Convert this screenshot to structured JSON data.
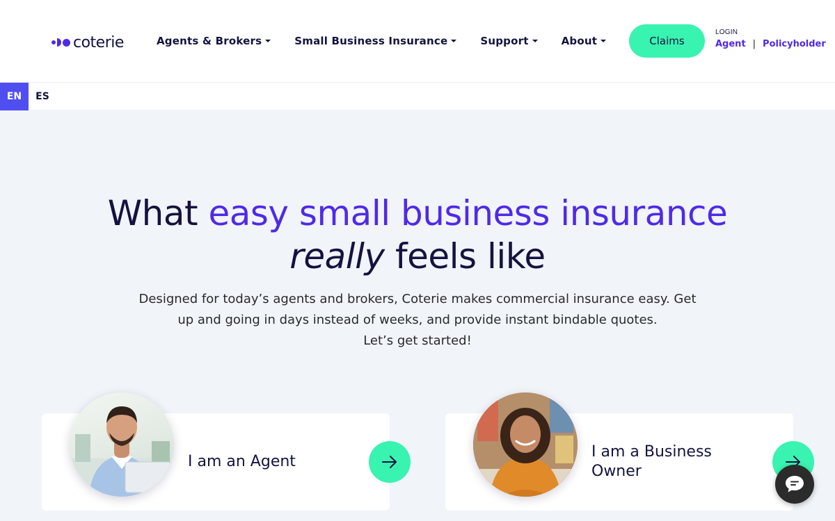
{
  "brand": {
    "name": "coterie",
    "color": "#4f2ae8"
  },
  "nav": {
    "items": [
      {
        "label": "Agents & Brokers"
      },
      {
        "label": "Small Business Insurance"
      },
      {
        "label": "Support"
      },
      {
        "label": "About"
      }
    ],
    "claims_label": "Claims"
  },
  "login": {
    "label": "LOGIN",
    "agent": "Agent",
    "separator": "|",
    "policyholder": "Policyholder"
  },
  "languages": {
    "active": "EN",
    "other": "ES"
  },
  "hero": {
    "title_part1": "What ",
    "title_accent": "easy small business insurance",
    "title_italic": "really",
    "title_part2": " feels like",
    "subtitle_line1": "Designed for today’s agents and brokers, Coterie makes commercial insurance easy. Get",
    "subtitle_line2": "up and going in days instead of weeks, and provide instant bindable quotes.",
    "subtitle_line3": "Let’s get started!"
  },
  "cards": {
    "agent": {
      "label": "I am an Agent",
      "icon": "arrow-right-icon"
    },
    "owner": {
      "label": "I am a Business Owner",
      "icon": "arrow-right-icon"
    }
  },
  "chat": {
    "icon": "chat-bubble-icon"
  },
  "colors": {
    "accent": "#4f2ae8",
    "mint": "#39f3b1",
    "navy": "#14133f",
    "background": "#f1f4f9",
    "lang_active": "#4f4ef0"
  }
}
